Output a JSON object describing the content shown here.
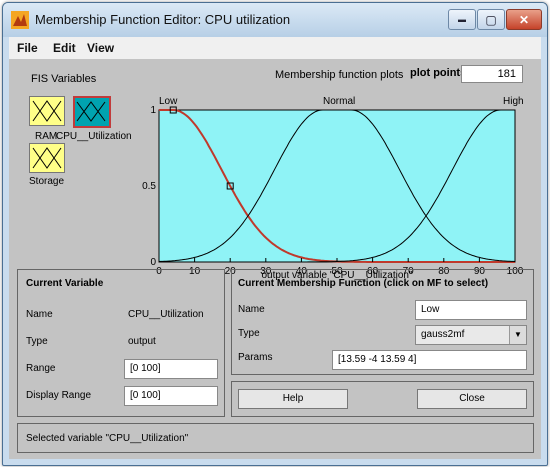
{
  "window": {
    "title": "Membership Function Editor: CPU utilization"
  },
  "window_controls": {
    "minimize": "▬",
    "maximize": "▢",
    "close": "✕"
  },
  "menu": [
    "File",
    "Edit",
    "View"
  ],
  "fis": {
    "label": "FIS Variables",
    "variables": [
      {
        "name": "RAM",
        "selected": false
      },
      {
        "name": "CPU__Utilization",
        "selected": true
      },
      {
        "name": "Storage",
        "selected": false
      }
    ]
  },
  "plot": {
    "title": "Membership function plots",
    "plot_points_label": "plot points:",
    "plot_points": "181",
    "xlabel": "output variable \"CPU__Utilization\"",
    "mf_names": [
      "Low",
      "Normal",
      "High"
    ]
  },
  "chart_data": {
    "type": "line",
    "x_ticks": [
      "0",
      "10",
      "20",
      "30",
      "40",
      "50",
      "60",
      "70",
      "80",
      "90",
      "100"
    ],
    "y_ticks": [
      "0",
      "0.5",
      "1"
    ],
    "xlim": [
      0,
      100
    ],
    "ylim": [
      0,
      1
    ],
    "series": [
      {
        "name": "Low",
        "color": "#c0392b",
        "mf": "gauss2mf",
        "params": [
          13.59,
          -4,
          13.59,
          4
        ]
      },
      {
        "name": "Normal",
        "color": "#000000",
        "mf": "gauss2mf",
        "params": [
          13.59,
          46,
          13.59,
          54
        ]
      },
      {
        "name": "High",
        "color": "#000000",
        "mf": "gauss2mf",
        "params": [
          13.59,
          96,
          13.59,
          104
        ]
      }
    ],
    "markers": [
      {
        "x": 4,
        "y": 1
      },
      {
        "x": 20,
        "y": 0.5
      }
    ]
  },
  "current_variable": {
    "title": "Current Variable",
    "name_label": "Name",
    "name": "CPU__Utilization",
    "type_label": "Type",
    "type": "output",
    "range_label": "Range",
    "range": "[0 100]",
    "display_range_label": "Display Range",
    "display_range": "[0 100]"
  },
  "current_mf": {
    "title": "Current Membership Function (click on MF to select)",
    "name_label": "Name",
    "name": "Low",
    "type_label": "Type",
    "type": "gauss2mf",
    "params_label": "Params",
    "params": "[13.59 -4 13.59 4]"
  },
  "buttons": {
    "help": "Help",
    "close": "Close"
  },
  "status": "Selected variable \"CPU__Utilization\""
}
